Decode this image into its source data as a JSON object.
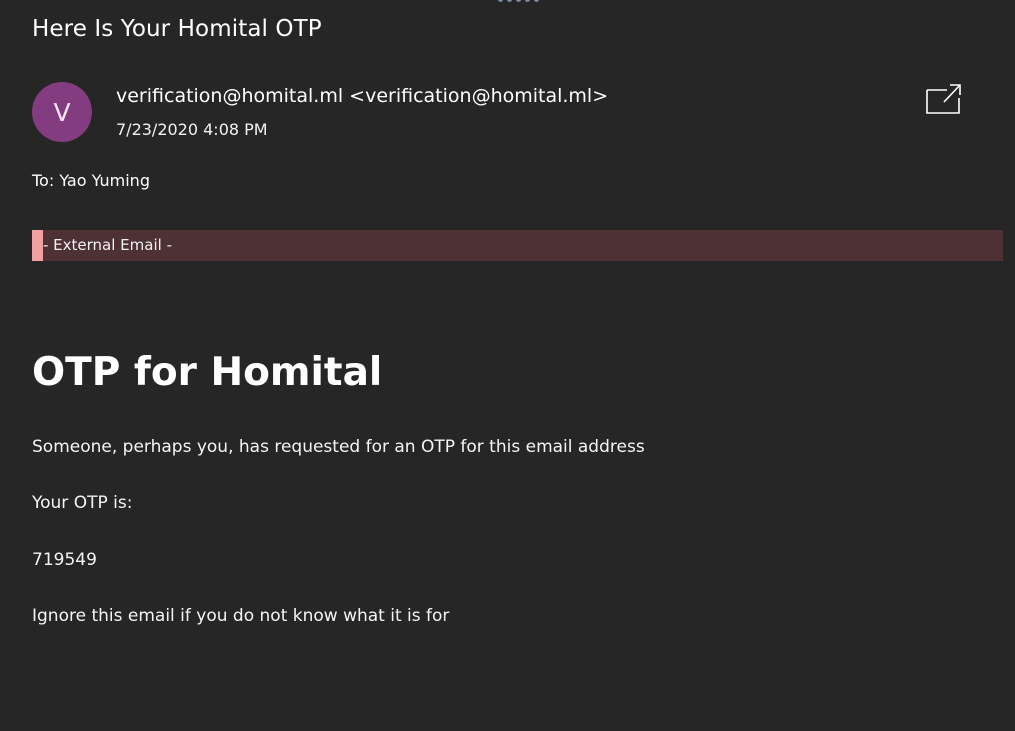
{
  "email": {
    "subject": "Here Is Your Homital OTP",
    "avatar_initial": "V",
    "sender": "verification@homital.ml <verification@homital.ml>",
    "date": "7/23/2020 4:08 PM",
    "to": "To: Yao Yuming",
    "external_label": "- External Email -",
    "popout_icon": "open-in-new-window-icon"
  },
  "body": {
    "heading": "OTP for Homital",
    "line1": "Someone, perhaps you, has requested for an OTP for this email address",
    "line2": "Your OTP is:",
    "otp_code": "719549",
    "line3": "Ignore this email if you do not know what it is for"
  },
  "colors": {
    "background": "#262626",
    "avatar": "#843c80",
    "external_banner": "#4e3135",
    "external_bar": "#f3a0a3"
  }
}
